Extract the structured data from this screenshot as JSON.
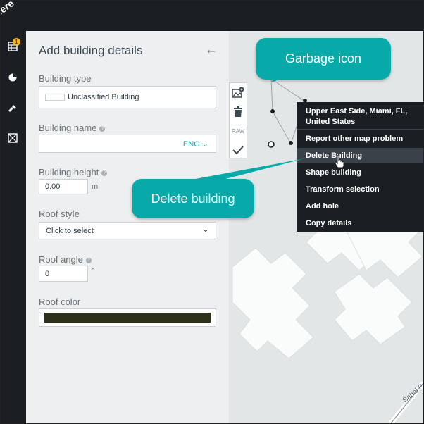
{
  "panel": {
    "title": "Add building details",
    "building_type": {
      "label": "Building type",
      "value": "Unclassified Building"
    },
    "building_name": {
      "label": "Building name",
      "value": "",
      "lang": "ENG"
    },
    "building_height": {
      "label": "Building height",
      "value": "0.00",
      "unit": "m"
    },
    "roof_style": {
      "label": "Roof style",
      "value": "Click to select"
    },
    "roof_angle": {
      "label": "Roof angle",
      "value": "0",
      "unit": "°"
    },
    "roof_color": {
      "label": "Roof color",
      "value": "#2e321a"
    }
  },
  "toolbar": {
    "raw_label": "RAW"
  },
  "context_menu": {
    "location": "Upper East Side, Miami, FL, United States",
    "items": [
      "Report other map problem",
      "Delete Building",
      "Shape building",
      "Transform selection",
      "Add hole",
      "Copy details"
    ],
    "highlighted": "Delete Building"
  },
  "map": {
    "street_label": "Sabal P"
  },
  "callouts": {
    "garbage": "Garbage icon",
    "delete": "Delete building"
  },
  "logo": {
    "text": "here"
  },
  "badge": {
    "count": "1"
  },
  "colors": {
    "accent": "#07aaa9",
    "dark": "#1b1f24",
    "panel": "#eeeff0",
    "map": "#e3e6e7"
  }
}
